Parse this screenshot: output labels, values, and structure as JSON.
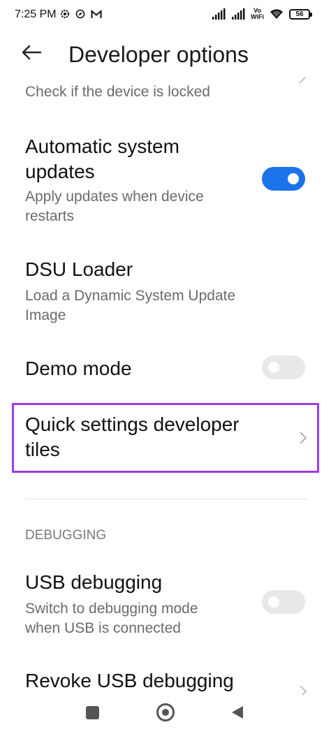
{
  "status_bar": {
    "time": "7:25 PM",
    "left_icons": [
      "gear-icon",
      "compass-icon",
      "gmail-icon"
    ],
    "right_icons": [
      "signal-icon",
      "signal-icon",
      "volte-wifi-icon",
      "wifi-icon",
      "battery-icon"
    ],
    "volte_line1": "Vo",
    "volte_line2": "WiFi",
    "battery_level": "56"
  },
  "app_bar": {
    "title": "Developer options",
    "back_icon": "arrow-left-icon"
  },
  "settings": {
    "device_locked_sub": "Check if the device is locked",
    "auto_updates": {
      "title_line1": "Automatic system",
      "title_line2": "updates",
      "sub_line1": "Apply updates when device",
      "sub_line2": "restarts",
      "enabled": true
    },
    "dsu_loader": {
      "title": "DSU Loader",
      "sub_line1": "Load a Dynamic System Update",
      "sub_line2": "Image"
    },
    "demo_mode": {
      "title": "Demo mode",
      "enabled": false
    },
    "quick_settings_tiles": {
      "title_line1": "Quick settings developer",
      "title_line2": "tiles"
    },
    "section_debugging": "DEBUGGING",
    "usb_debugging": {
      "title": "USB debugging",
      "sub_line1": "Switch to debugging mode",
      "sub_line2": "when USB is connected",
      "enabled": false
    },
    "revoke_usb_debugging": {
      "title": "Revoke USB debugging"
    }
  },
  "colors": {
    "accent": "#1a73e8",
    "highlight_border": "#9b3bf0",
    "subtitle": "#6b6b6b"
  },
  "nav_bar": {
    "icons": [
      "recents-square-icon",
      "home-circle-icon",
      "back-triangle-icon"
    ]
  }
}
